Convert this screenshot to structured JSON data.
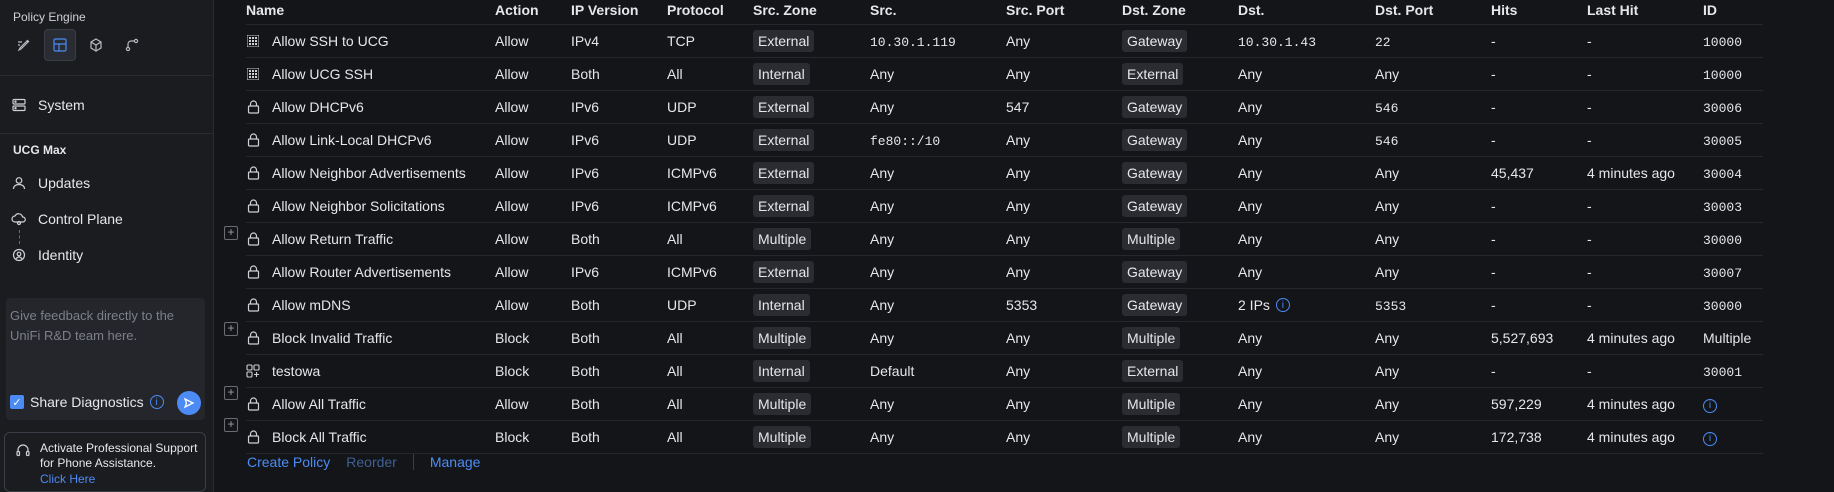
{
  "sidebar": {
    "policy_engine_label": "Policy Engine",
    "system_label": "System",
    "device_label": "UCG Max",
    "updates_label": "Updates",
    "control_plane_label": "Control Plane",
    "identity_label": "Identity",
    "feedback_placeholder": "Give feedback directly to the UniFi R&D team here.",
    "share_diagnostics_label": "Share Diagnostics",
    "support_text": "Activate Professional Support for Phone Assistance.",
    "support_link": "Click Here"
  },
  "table": {
    "headers": [
      "Name",
      "Action",
      "IP Version",
      "Protocol",
      "Src. Zone",
      "Src.",
      "Src. Port",
      "Dst. Zone",
      "Dst.",
      "Dst. Port",
      "Hits",
      "Last Hit",
      "ID"
    ],
    "rows": [
      {
        "name": "Allow SSH to UCG",
        "action": "Allow",
        "ip": "IPv4",
        "protocol": "TCP",
        "src_zone": "External",
        "src": "10.30.1.119",
        "src_port": "Any",
        "dst_zone": "Gateway",
        "dst": "10.30.1.43",
        "dst_port": "22",
        "hits": "-",
        "last_hit": "-",
        "id": "10000"
      },
      {
        "name": "Allow UCG SSH",
        "action": "Allow",
        "ip": "Both",
        "protocol": "All",
        "src_zone": "Internal",
        "src": "Any",
        "src_port": "Any",
        "dst_zone": "External",
        "dst": "Any",
        "dst_port": "Any",
        "hits": "-",
        "last_hit": "-",
        "id": "10000"
      },
      {
        "name": "Allow DHCPv6",
        "action": "Allow",
        "ip": "IPv6",
        "protocol": "UDP",
        "src_zone": "External",
        "src": "Any",
        "src_port": "547",
        "dst_zone": "Gateway",
        "dst": "Any",
        "dst_port": "546",
        "hits": "-",
        "last_hit": "-",
        "id": "30006"
      },
      {
        "name": "Allow Link-Local DHCPv6",
        "action": "Allow",
        "ip": "IPv6",
        "protocol": "UDP",
        "src_zone": "External",
        "src": "fe80::/10",
        "src_port": "Any",
        "dst_zone": "Gateway",
        "dst": "Any",
        "dst_port": "546",
        "hits": "-",
        "last_hit": "-",
        "id": "30005"
      },
      {
        "name": "Allow Neighbor Advertisements",
        "action": "Allow",
        "ip": "IPv6",
        "protocol": "ICMPv6",
        "src_zone": "External",
        "src": "Any",
        "src_port": "Any",
        "dst_zone": "Gateway",
        "dst": "Any",
        "dst_port": "Any",
        "hits": "45,437",
        "last_hit": "4 minutes ago",
        "id": "30004"
      },
      {
        "name": "Allow Neighbor Solicitations",
        "action": "Allow",
        "ip": "IPv6",
        "protocol": "ICMPv6",
        "src_zone": "External",
        "src": "Any",
        "src_port": "Any",
        "dst_zone": "Gateway",
        "dst": "Any",
        "dst_port": "Any",
        "hits": "-",
        "last_hit": "-",
        "id": "30003"
      },
      {
        "name": "Allow Return Traffic",
        "action": "Allow",
        "ip": "Both",
        "protocol": "All",
        "src_zone": "Multiple",
        "src": "Any",
        "src_port": "Any",
        "dst_zone": "Multiple",
        "dst": "Any",
        "dst_port": "Any",
        "hits": "-",
        "last_hit": "-",
        "id": "30000"
      },
      {
        "name": "Allow Router Advertisements",
        "action": "Allow",
        "ip": "IPv6",
        "protocol": "ICMPv6",
        "src_zone": "External",
        "src": "Any",
        "src_port": "Any",
        "dst_zone": "Gateway",
        "dst": "Any",
        "dst_port": "Any",
        "hits": "-",
        "last_hit": "-",
        "id": "30007"
      },
      {
        "name": "Allow mDNS",
        "action": "Allow",
        "ip": "Both",
        "protocol": "UDP",
        "src_zone": "Internal",
        "src": "Any",
        "src_port": "5353",
        "dst_zone": "Gateway",
        "dst": "2 IPs",
        "dst_port": "5353",
        "hits": "-",
        "last_hit": "-",
        "id": "30000"
      },
      {
        "name": "Block Invalid Traffic",
        "action": "Block",
        "ip": "Both",
        "protocol": "All",
        "src_zone": "Multiple",
        "src": "Any",
        "src_port": "Any",
        "dst_zone": "Multiple",
        "dst": "Any",
        "dst_port": "Any",
        "hits": "5,527,693",
        "last_hit": "4 minutes ago",
        "id": "Multiple"
      },
      {
        "name": "testowa",
        "action": "Block",
        "ip": "Both",
        "protocol": "All",
        "src_zone": "Internal",
        "src": "Default",
        "src_port": "Any",
        "dst_zone": "External",
        "dst": "Any",
        "dst_port": "Any",
        "hits": "-",
        "last_hit": "-",
        "id": "30001"
      },
      {
        "name": "Allow All Traffic",
        "action": "Allow",
        "ip": "Both",
        "protocol": "All",
        "src_zone": "Multiple",
        "src": "Any",
        "src_port": "Any",
        "dst_zone": "Multiple",
        "dst": "Any",
        "dst_port": "Any",
        "hits": "597,229",
        "last_hit": "4 minutes ago",
        "id": ""
      },
      {
        "name": "Block All Traffic",
        "action": "Block",
        "ip": "Both",
        "protocol": "All",
        "src_zone": "Multiple",
        "src": "Any",
        "src_port": "Any",
        "dst_zone": "Multiple",
        "dst": "Any",
        "dst_port": "Any",
        "hits": "172,738",
        "last_hit": "4 minutes ago",
        "id": ""
      }
    ]
  },
  "footer": {
    "create_label": "Create Policy",
    "reorder_label": "Reorder",
    "manage_label": "Manage"
  }
}
